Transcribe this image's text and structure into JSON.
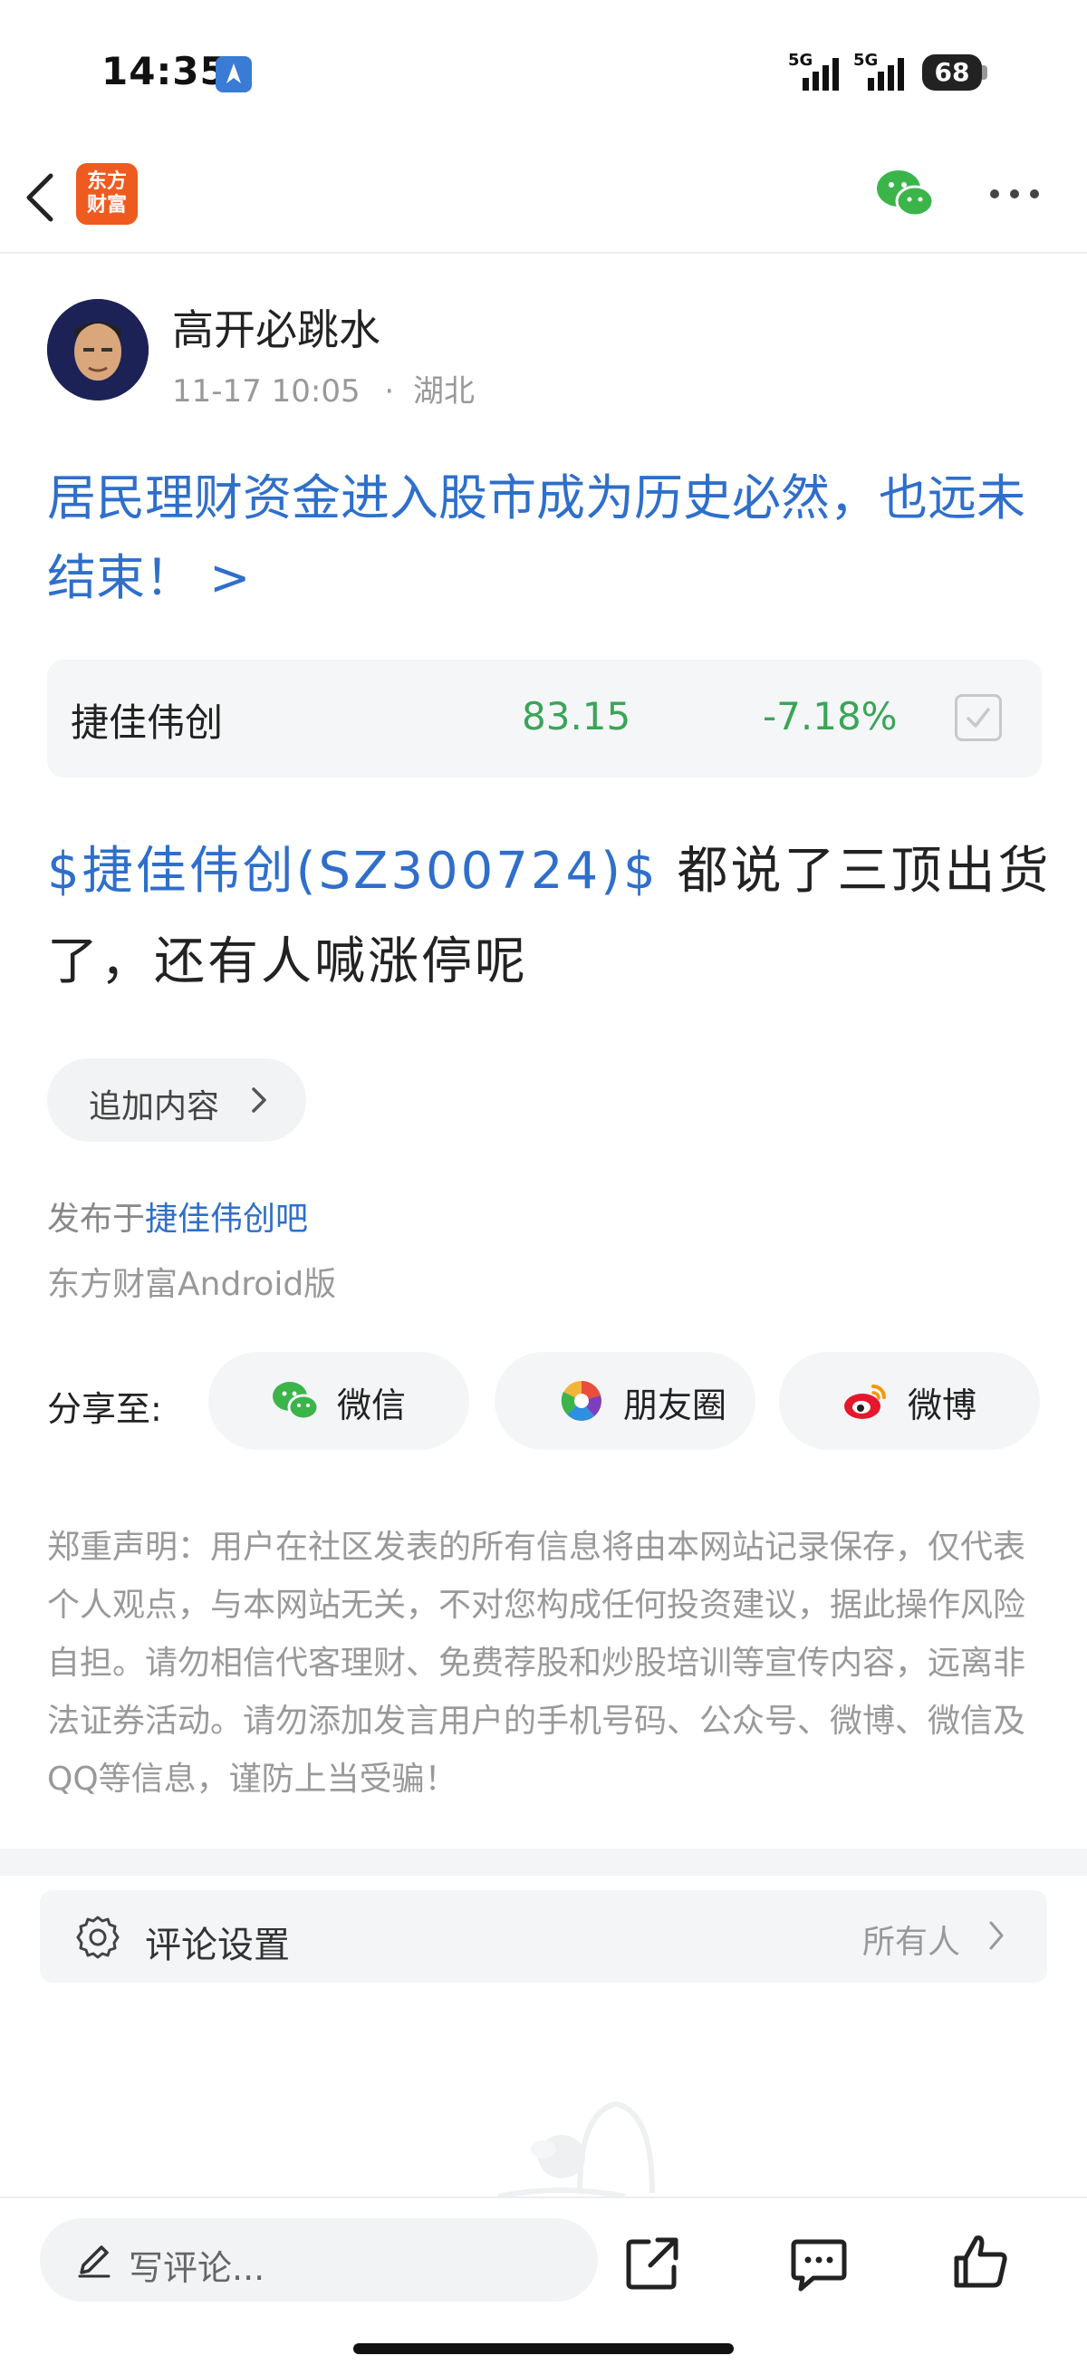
{
  "status_bar": {
    "time": "14:35",
    "network_1": "5G",
    "network_2": "5G",
    "battery": "68"
  },
  "nav": {
    "app_logo_line1": "东方",
    "app_logo_line2": "财富"
  },
  "author": {
    "name": "高开必跳水",
    "time": "11-17 10:05",
    "location": "湖北",
    "separator": "·"
  },
  "post": {
    "title": "居民理财资金进入股市成为历史必然，也远未结束！ >",
    "stock_link": "$捷佳伟创(SZ300724)$",
    "body": " 都说了三顶出货了，还有人喊涨停呢"
  },
  "stock_card": {
    "name": "捷佳伟创",
    "price": "83.15",
    "change": "-7.18%",
    "color": "#3aa558"
  },
  "append_button": "追加内容",
  "published": {
    "prefix": "发布于",
    "bar": "捷佳伟创吧",
    "client": "东方财富Android版"
  },
  "share": {
    "label": "分享至:",
    "items": [
      {
        "label": "微信",
        "icon": "wechat-icon"
      },
      {
        "label": "朋友圈",
        "icon": "moments-icon"
      },
      {
        "label": "微博",
        "icon": "weibo-icon"
      }
    ]
  },
  "disclaimer": "郑重声明：用户在社区发表的所有信息将由本网站记录保存，仅代表个人观点，与本网站无关，不对您构成任何投资建议，据此操作风险自担。请勿相信代客理财、免费荐股和炒股培训等宣传内容，远离非法证券活动。请勿添加发言用户的手机号码、公众号、微博、微信及QQ等信息，谨防上当受骗！",
  "comment_setting": {
    "label": "评论设置",
    "value": "所有人"
  },
  "bottom_bar": {
    "placeholder": "写评论..."
  },
  "colors": {
    "link_blue": "#2f6fcb",
    "brand_orange": "#ef5a1f",
    "down_green": "#3aa558"
  }
}
